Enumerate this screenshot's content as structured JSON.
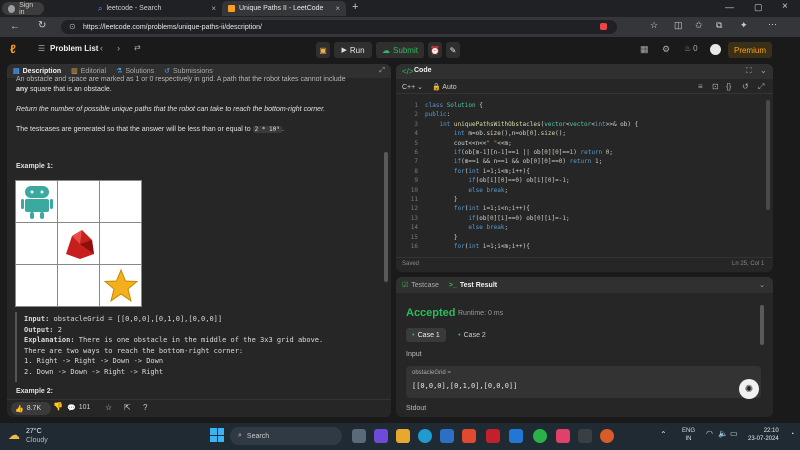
{
  "browser": {
    "tabs": [
      {
        "label": "Sign in"
      },
      {
        "label": "leetcode - Search"
      },
      {
        "label": "Unique Paths II - LeetCode"
      }
    ],
    "url": "https://leetcode.com/problems/unique-paths-ii/description/"
  },
  "lcbar": {
    "problem_list": "Problem List",
    "run": "Run",
    "submit": "Submit",
    "streak": "0",
    "premium": "Premium"
  },
  "left": {
    "tabs": [
      "Description",
      "Editorial",
      "Solutions",
      "Submissions"
    ],
    "top_partial": "An obstacle and space are marked as 1 or 0 respectively in grid. A path that the robot takes cannot include",
    "any_bold": "any",
    "any_rest": "square that is an obstacle.",
    "return_text": "Return the number of possible unique paths that the robot can take to reach the bottom-right corner.",
    "testcase_text": "The testcases are generated so that the answer will be less than or equal to",
    "testcase_code": "2 * 10⁹",
    "testcase_end": ".",
    "example1": "Example 1:",
    "input_label": "Input:",
    "input_val": "obstacleGrid = [[0,0,0],[0,1,0],[0,0,0]]",
    "output_label": "Output:",
    "output_val": "2",
    "expl_label": "Explanation:",
    "expl_val": "There is one obstacle in the middle of the 3x3 grid above.",
    "expl_l2": "There are two ways to reach the bottom-right corner:",
    "expl_l3": "1. Right -> Right -> Down -> Down",
    "expl_l4": "2. Down -> Down -> Right -> Right",
    "example2": "Example 2:",
    "likes": "8.7K",
    "comments": "101"
  },
  "code": {
    "title": "Code",
    "lang": "C++",
    "auto": "Auto",
    "saved": "Saved",
    "cursor": "Ln 25, Col 1",
    "lines": [
      "1",
      "2",
      "3",
      "4",
      "5",
      "6",
      "7",
      "8",
      "9",
      "10",
      "11",
      "12",
      "13",
      "14",
      "15",
      "16"
    ]
  },
  "bottom": {
    "tabs": [
      "Testcase",
      "Test Result"
    ],
    "accepted": "Accepted",
    "runtime": "Runtime: 0 ms",
    "case1": "Case 1",
    "case2": "Case 2",
    "input": "Input",
    "param": "obstacleGrid =",
    "param_val": "[[0,0,0],[0,1,0],[0,0,0]]",
    "stdout": "Stdout"
  },
  "taskbar": {
    "temp": "27°C",
    "weather": "Cloudy",
    "search": "Search",
    "lang1": "ENG",
    "lang2": "IN",
    "time": "22:10",
    "date": "23-07-2024"
  }
}
